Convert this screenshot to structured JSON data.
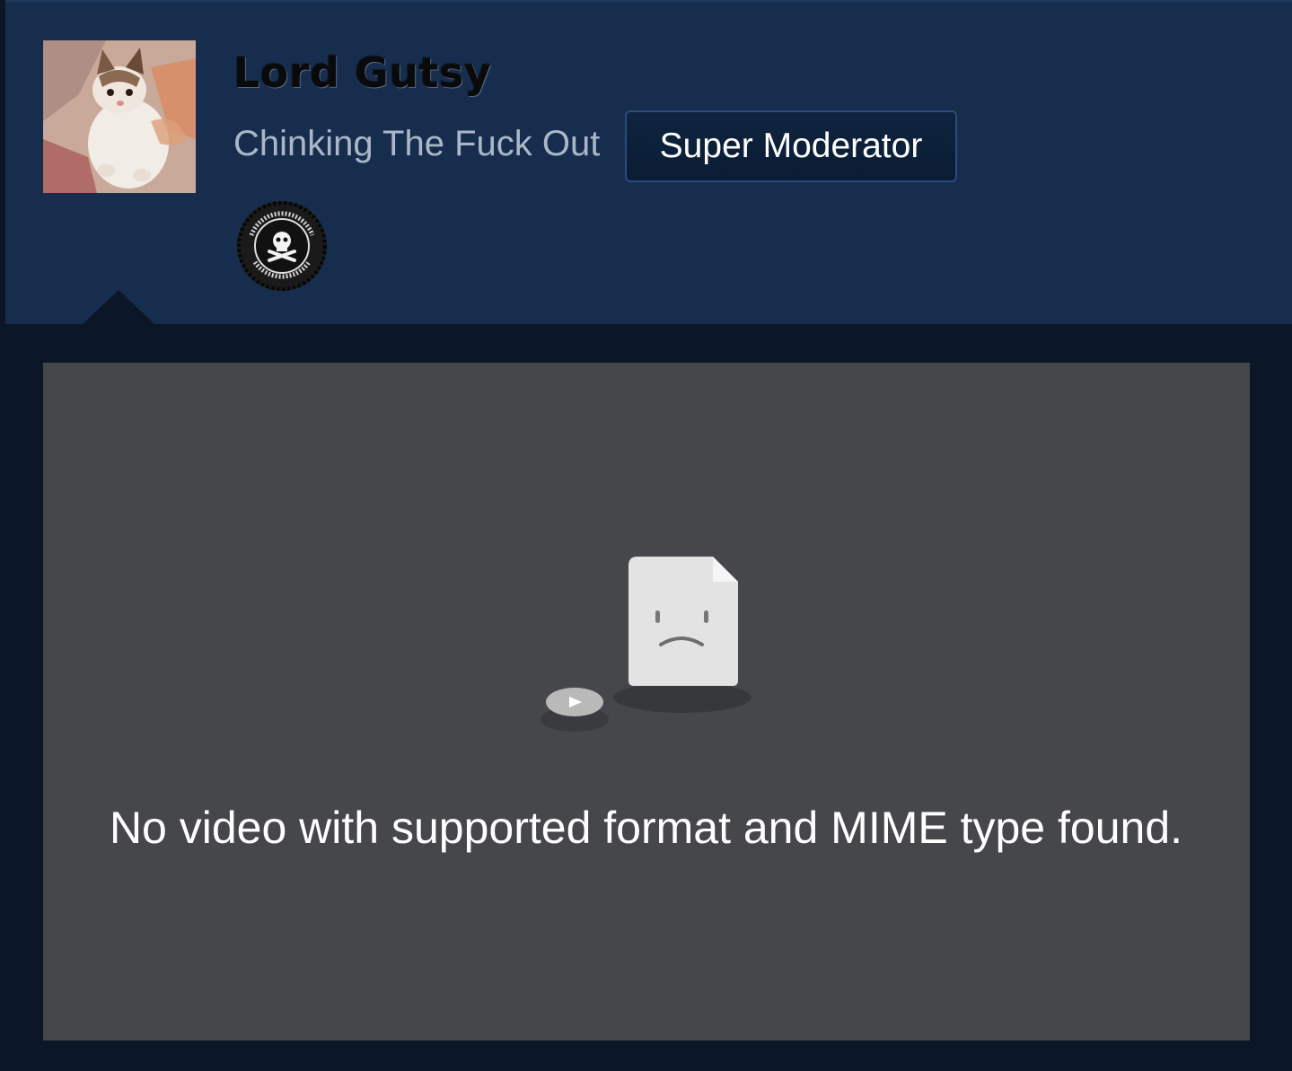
{
  "profile": {
    "username": "Lord Gutsy",
    "title": "Chinking The Fuck Out",
    "role_badge": "Super Moderator",
    "avatar_icon": "kitten-avatar",
    "award_icon": "skull-crossbones-badge-icon"
  },
  "video": {
    "error_message": "No video with supported format and MIME type found.",
    "error_icon": "sad-file-icon"
  },
  "colors": {
    "header_bg": "#172d4d",
    "page_bg": "#0b1726",
    "video_bg": "#46474b",
    "badge_border": "#2a4c7e"
  }
}
